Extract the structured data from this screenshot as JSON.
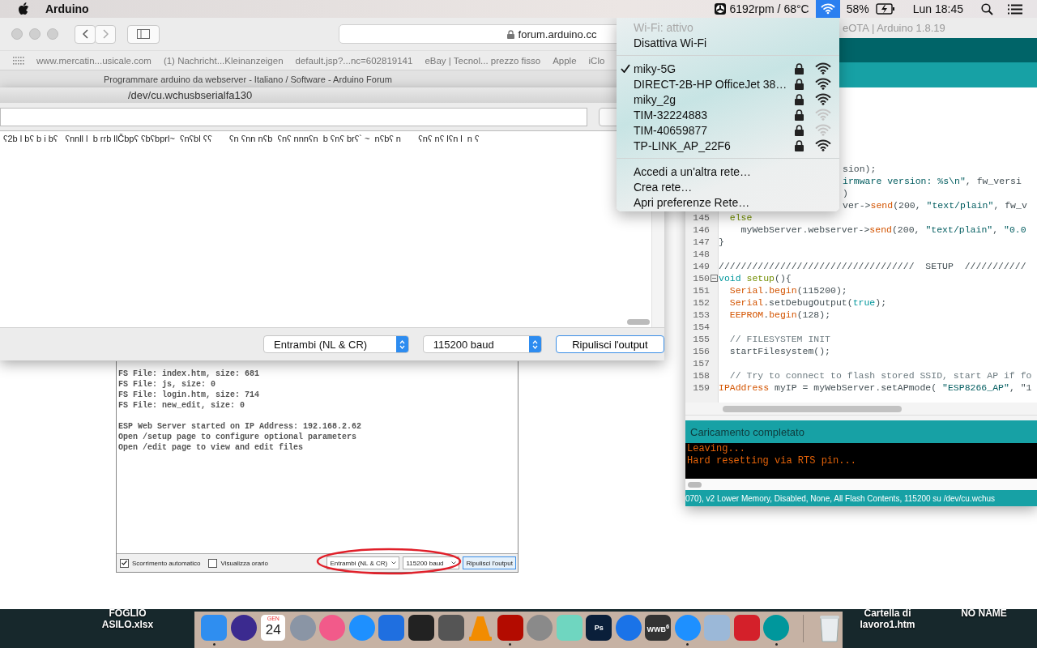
{
  "menubar": {
    "app": "Arduino",
    "fan": "6192rpm / 68°C",
    "battery": "58%",
    "clock": "Lun 18:45"
  },
  "safari": {
    "url": "forum.arduino.cc",
    "bookmarks": [
      "www.mercatin...usicale.com",
      "(1) Nachricht...Kleinanzeigen",
      "default.jsp?...nc=602819141",
      "eBay | Tecnol... prezzo fisso",
      "Apple",
      "iClo"
    ],
    "tab_title": "Programmare arduino da webserver - Italiano / Software - Arduino Forum"
  },
  "serial_monitor": {
    "title": "/dev/cu.wchusbserialfa130",
    "output": "ʕ2b l bʕ b i bʕ   ʕnnll l  b rrb llČbpʕ ʕbʕbprl~  ʕnʕbl ʕʕ       ʕn ʕnn nʕb  ʕnʕ nnnʕn  b ʕnʕ brʕ` ~  nʕbʕ n       ʕnʕ nʕ lʕn l  n ʕ",
    "line_ending": "Entrambi (NL & CR)",
    "baud": "115200 baud",
    "clear_button": "Ripulisci l'output"
  },
  "forum_image": {
    "lines": [
      "FS File: index.htm, size: 681",
      "FS File: js, size: 0",
      "FS File: login.htm, size: 714",
      "FS File: new_edit, size: 0",
      "ESP Web Server started on IP Address: 192.168.2.62",
      "Open /setup page to configure optional parameters",
      "Open /edit page to view and edit files"
    ],
    "autoscroll": {
      "label": "Scorrimento automatico",
      "checked": true
    },
    "timestamp": {
      "label": "Visualizza orario",
      "checked": false
    },
    "line_ending": "Entrambi (NL & CR)",
    "baud": "115200 baud",
    "clear_button": "Ripulisci l'output"
  },
  "ide": {
    "title": "eOTA | Arduino 1.8.19",
    "code": [
      {
        "kind": "fragment",
        "segments": [
          {
            "kind": "plain",
            "text": "sion);"
          }
        ]
      },
      {
        "kind": "fragment",
        "segments": [
          {
            "kind": "string",
            "text": "irmware version: %s\\n\""
          },
          {
            "kind": "plain",
            "text": ", fw_versi"
          }
        ]
      },
      {
        "kind": "fragment",
        "segments": [
          {
            "kind": "plain",
            "text": ")"
          }
        ]
      },
      {
        "kind": "fragment",
        "segments": [
          {
            "kind": "plain",
            "text": "ver->"
          },
          {
            "kind": "func",
            "text": "send"
          },
          {
            "kind": "plain",
            "text": "(200, "
          },
          {
            "kind": "string",
            "text": "\"text/plain\""
          },
          {
            "kind": "plain",
            "text": ", fw_v"
          }
        ]
      },
      {
        "kind": "line",
        "number": "145",
        "fold": false,
        "segments": [
          {
            "kind": "control",
            "text": "  else"
          }
        ]
      },
      {
        "kind": "line",
        "number": "146",
        "fold": false,
        "segments": [
          {
            "kind": "plain",
            "text": "    myWebServer.webserver->"
          },
          {
            "kind": "func",
            "text": "send"
          },
          {
            "kind": "plain",
            "text": "(200, "
          },
          {
            "kind": "string",
            "text": "\"text/plain\""
          },
          {
            "kind": "plain",
            "text": ", "
          },
          {
            "kind": "string",
            "text": "\"0.0"
          }
        ]
      },
      {
        "kind": "line",
        "number": "147",
        "fold": false,
        "segments": [
          {
            "kind": "plain",
            "text": "}"
          }
        ]
      },
      {
        "kind": "line",
        "number": "148",
        "fold": false
      },
      {
        "kind": "line",
        "number": "149",
        "fold": false,
        "segments": [
          {
            "kind": "plain",
            "text": "///////////////////////////////////  SETUP  ///////////"
          }
        ]
      },
      {
        "kind": "line",
        "number": "150",
        "fold": true,
        "segments": [
          {
            "kind": "keyword",
            "text": "void"
          },
          {
            "kind": "control",
            "text": " setup"
          },
          {
            "kind": "plain",
            "text": "(){"
          }
        ]
      },
      {
        "kind": "line",
        "number": "151",
        "fold": false,
        "segments": [
          {
            "kind": "func",
            "text": "  Serial"
          },
          {
            "kind": "plain",
            "text": "."
          },
          {
            "kind": "func",
            "text": "begin"
          },
          {
            "kind": "plain",
            "text": "(115200);"
          }
        ]
      },
      {
        "kind": "line",
        "number": "152",
        "fold": false,
        "segments": [
          {
            "kind": "func",
            "text": "  Serial"
          },
          {
            "kind": "plain",
            "text": ".setDebugOutput("
          },
          {
            "kind": "keyword",
            "text": "true"
          },
          {
            "kind": "plain",
            "text": ");"
          }
        ]
      },
      {
        "kind": "line",
        "number": "153",
        "fold": false,
        "segments": [
          {
            "kind": "func",
            "text": "  EEPROM"
          },
          {
            "kind": "plain",
            "text": "."
          },
          {
            "kind": "func",
            "text": "begin"
          },
          {
            "kind": "plain",
            "text": "(128);"
          }
        ]
      },
      {
        "kind": "line",
        "number": "154",
        "fold": false
      },
      {
        "kind": "line",
        "number": "155",
        "fold": false,
        "segments": [
          {
            "kind": "comment",
            "text": "  // FILESYSTEM INIT"
          }
        ]
      },
      {
        "kind": "line",
        "number": "156",
        "fold": false,
        "segments": [
          {
            "kind": "plain",
            "text": "  startFilesystem();"
          }
        ]
      },
      {
        "kind": "line",
        "number": "157",
        "fold": false
      },
      {
        "kind": "line",
        "number": "158",
        "fold": false,
        "segments": [
          {
            "kind": "comment",
            "text": "  // Try to connect to flash stored SSID, start AP if fo"
          }
        ]
      },
      {
        "kind": "line",
        "number": "159",
        "fold": false,
        "segments": [
          {
            "kind": "func",
            "text": "IPAddress"
          },
          {
            "kind": "plain",
            "text": " myIP = myWebServer.setAPmode( "
          },
          {
            "kind": "string",
            "text": "\"ESP8266_AP\""
          },
          {
            "kind": "plain",
            "text": ", \"1"
          }
        ]
      }
    ],
    "status": "Caricamento completato",
    "console": [
      "Leaving...",
      "Hard resetting via RTS pin..."
    ],
    "board_status": "070), v2 Lower Memory, Disabled, None, All Flash Contents, 115200 su /dev/cu.wchus"
  },
  "wifi_menu": {
    "status": "Wi-Fi: attivo",
    "toggle": "Disattiva Wi-Fi",
    "networks": [
      {
        "name": "miky-5G",
        "selected": true,
        "locked": true,
        "weak": false
      },
      {
        "name": "DIRECT-2B-HP OfficeJet 38…",
        "selected": false,
        "locked": true,
        "weak": false
      },
      {
        "name": "miky_2g",
        "selected": false,
        "locked": true,
        "weak": false
      },
      {
        "name": "TIM-32224883",
        "selected": false,
        "locked": true,
        "weak": true
      },
      {
        "name": "TIM-40659877",
        "selected": false,
        "locked": true,
        "weak": true
      },
      {
        "name": "TP-LINK_AP_22F6",
        "selected": false,
        "locked": true,
        "weak": false
      }
    ],
    "actions": [
      "Accedi a un'altra rete…",
      "Crea rete…",
      "Apri preferenze Rete…"
    ]
  },
  "desktop_files": [
    {
      "name": "FOGLIO ASILO.xlsx"
    },
    {
      "name": "Cartella di lavoro1.htm"
    },
    {
      "name": "NO NAME"
    }
  ],
  "dock": [
    {
      "kind": "square",
      "color": "#2f8ef0",
      "running": true
    },
    {
      "kind": "round",
      "color": "#3b2a8f",
      "running": false
    },
    {
      "kind": "calendar",
      "month": "GEN",
      "day": "24",
      "running": false
    },
    {
      "kind": "round",
      "color": "#8a95a5",
      "running": false
    },
    {
      "kind": "round",
      "color": "#f25a8a",
      "running": false
    },
    {
      "kind": "round",
      "color": "#1e90ff",
      "running": false
    },
    {
      "kind": "square",
      "color": "#1f6fe0",
      "running": false
    },
    {
      "kind": "square",
      "color": "#222222",
      "running": false
    },
    {
      "kind": "square",
      "color": "#555555",
      "running": false
    },
    {
      "kind": "cone",
      "color": "#f28c00",
      "running": false
    },
    {
      "kind": "square",
      "color": "#b30b00",
      "running": true
    },
    {
      "kind": "round",
      "color": "#8a8a8a",
      "running": false
    },
    {
      "kind": "square",
      "color": "#6fd6c0",
      "running": false
    },
    {
      "kind": "square",
      "color": "#0a1f3a",
      "text": "Ps",
      "running": false
    },
    {
      "kind": "round",
      "color": "#1a73e8",
      "running": false
    },
    {
      "kind": "square",
      "color": "#333333",
      "text": "WWB$^{6}$",
      "running": false
    },
    {
      "kind": "round",
      "color": "#1e90ff",
      "running": true
    },
    {
      "kind": "square",
      "color": "#9bb8d8",
      "running": false
    },
    {
      "kind": "square",
      "color": "#d4202a",
      "running": false
    },
    {
      "kind": "round",
      "color": "#00979c",
      "running": true
    },
    {
      "kind": "trash",
      "running": false
    }
  ]
}
